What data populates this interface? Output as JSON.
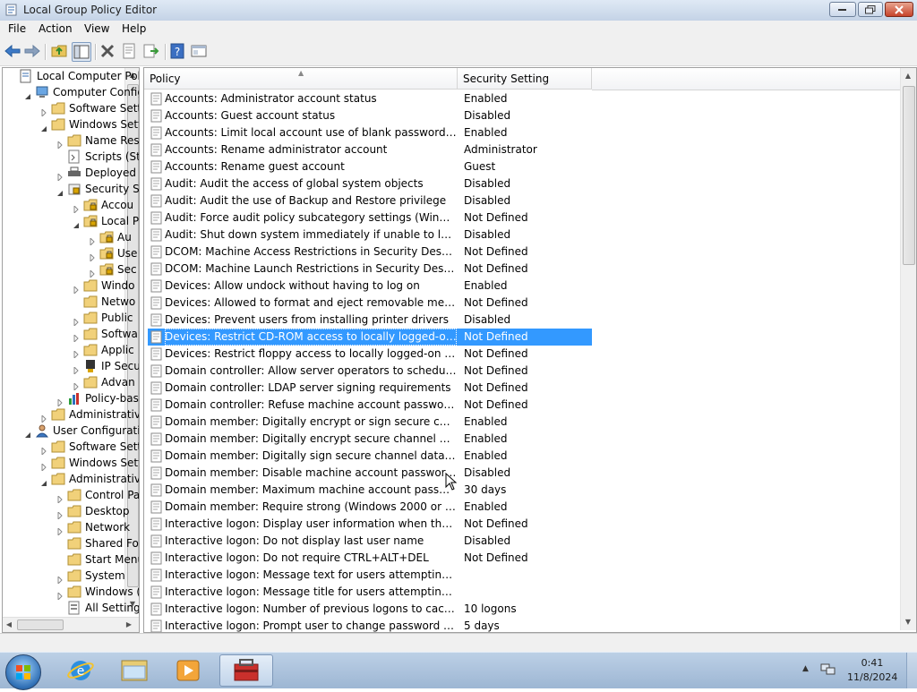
{
  "window": {
    "title": "Local Group Policy Editor"
  },
  "menu": [
    "File",
    "Action",
    "View",
    "Help"
  ],
  "toolbar": {
    "icons": [
      "back-arrow-icon",
      "forward-arrow-icon",
      "up-folder-icon",
      "show-hide-tree-icon",
      "delete-icon",
      "properties-icon",
      "export-list-icon",
      "help-icon",
      "console-view-icon"
    ]
  },
  "tree": {
    "nodes": [
      {
        "label": "Local Computer Polic",
        "depth": 0,
        "arrow": "none",
        "icon": "policy-doc"
      },
      {
        "label": "Computer Config",
        "depth": 1,
        "arrow": "expanded",
        "icon": "computer"
      },
      {
        "label": "Software Setti",
        "depth": 2,
        "arrow": "collapsed",
        "icon": "folder"
      },
      {
        "label": "Windows Sett",
        "depth": 2,
        "arrow": "expanded",
        "icon": "folder"
      },
      {
        "label": "Name Res",
        "depth": 3,
        "arrow": "collapsed",
        "icon": "folder"
      },
      {
        "label": "Scripts (Sta",
        "depth": 3,
        "arrow": "none",
        "icon": "script"
      },
      {
        "label": "Deployed",
        "depth": 3,
        "arrow": "collapsed",
        "icon": "printer"
      },
      {
        "label": "Security Se",
        "depth": 3,
        "arrow": "expanded",
        "icon": "security"
      },
      {
        "label": "Accou",
        "depth": 4,
        "arrow": "collapsed",
        "icon": "folder-lock"
      },
      {
        "label": "Local P",
        "depth": 4,
        "arrow": "expanded",
        "icon": "folder-lock"
      },
      {
        "label": "Au",
        "depth": 5,
        "arrow": "collapsed",
        "icon": "folder-lock"
      },
      {
        "label": "Use",
        "depth": 5,
        "arrow": "collapsed",
        "icon": "folder-lock"
      },
      {
        "label": "Sec",
        "depth": 5,
        "arrow": "collapsed",
        "icon": "folder-lock"
      },
      {
        "label": "Windo",
        "depth": 4,
        "arrow": "collapsed",
        "icon": "folder"
      },
      {
        "label": "Netwo",
        "depth": 4,
        "arrow": "none",
        "icon": "folder"
      },
      {
        "label": "Public",
        "depth": 4,
        "arrow": "collapsed",
        "icon": "folder"
      },
      {
        "label": "Softwa",
        "depth": 4,
        "arrow": "collapsed",
        "icon": "folder"
      },
      {
        "label": "Applic",
        "depth": 4,
        "arrow": "collapsed",
        "icon": "folder"
      },
      {
        "label": "IP Secu",
        "depth": 4,
        "arrow": "collapsed",
        "icon": "ipsec"
      },
      {
        "label": "Advan",
        "depth": 4,
        "arrow": "collapsed",
        "icon": "folder"
      },
      {
        "label": "Policy-bas",
        "depth": 3,
        "arrow": "collapsed",
        "icon": "chart"
      },
      {
        "label": "Administrative",
        "depth": 2,
        "arrow": "collapsed",
        "icon": "folder"
      },
      {
        "label": "User Configuratio",
        "depth": 1,
        "arrow": "expanded",
        "icon": "user"
      },
      {
        "label": "Software Setti",
        "depth": 2,
        "arrow": "collapsed",
        "icon": "folder"
      },
      {
        "label": "Windows Sett",
        "depth": 2,
        "arrow": "collapsed",
        "icon": "folder"
      },
      {
        "label": "Administrative",
        "depth": 2,
        "arrow": "expanded",
        "icon": "folder"
      },
      {
        "label": "Control Pa",
        "depth": 3,
        "arrow": "collapsed",
        "icon": "folder"
      },
      {
        "label": "Desktop",
        "depth": 3,
        "arrow": "collapsed",
        "icon": "folder"
      },
      {
        "label": "Network",
        "depth": 3,
        "arrow": "collapsed",
        "icon": "folder"
      },
      {
        "label": "Shared Fol",
        "depth": 3,
        "arrow": "none",
        "icon": "folder"
      },
      {
        "label": "Start Menu",
        "depth": 3,
        "arrow": "none",
        "icon": "folder"
      },
      {
        "label": "System",
        "depth": 3,
        "arrow": "collapsed",
        "icon": "folder"
      },
      {
        "label": "Windows (",
        "depth": 3,
        "arrow": "collapsed",
        "icon": "folder"
      },
      {
        "label": "All Setting",
        "depth": 3,
        "arrow": "none",
        "icon": "all-settings"
      }
    ]
  },
  "list": {
    "columns": [
      "Policy",
      "Security Setting"
    ],
    "selected_index": 14,
    "rows": [
      {
        "policy": "Accounts: Administrator account status",
        "setting": "Enabled"
      },
      {
        "policy": "Accounts: Guest account status",
        "setting": "Disabled"
      },
      {
        "policy": "Accounts: Limit local account use of blank passwords to co...",
        "setting": "Enabled"
      },
      {
        "policy": "Accounts: Rename administrator account",
        "setting": "Administrator"
      },
      {
        "policy": "Accounts: Rename guest account",
        "setting": "Guest"
      },
      {
        "policy": "Audit: Audit the access of global system objects",
        "setting": "Disabled"
      },
      {
        "policy": "Audit: Audit the use of Backup and Restore privilege",
        "setting": "Disabled"
      },
      {
        "policy": "Audit: Force audit policy subcategory settings (Windows Vis...",
        "setting": "Not Defined"
      },
      {
        "policy": "Audit: Shut down system immediately if unable to log secur...",
        "setting": "Disabled"
      },
      {
        "policy": "DCOM: Machine Access Restrictions in Security Descriptor D...",
        "setting": "Not Defined"
      },
      {
        "policy": "DCOM: Machine Launch Restrictions in Security Descriptor ...",
        "setting": "Not Defined"
      },
      {
        "policy": "Devices: Allow undock without having to log on",
        "setting": "Enabled"
      },
      {
        "policy": "Devices: Allowed to format and eject removable media",
        "setting": "Not Defined"
      },
      {
        "policy": "Devices: Prevent users from installing printer drivers",
        "setting": "Disabled"
      },
      {
        "policy": "Devices: Restrict CD-ROM access to locally logged-on user ...",
        "setting": "Not Defined"
      },
      {
        "policy": "Devices: Restrict floppy access to locally logged-on user only",
        "setting": "Not Defined"
      },
      {
        "policy": "Domain controller: Allow server operators to schedule tasks",
        "setting": "Not Defined"
      },
      {
        "policy": "Domain controller: LDAP server signing requirements",
        "setting": "Not Defined"
      },
      {
        "policy": "Domain controller: Refuse machine account password chan...",
        "setting": "Not Defined"
      },
      {
        "policy": "Domain member: Digitally encrypt or sign secure channel d...",
        "setting": "Enabled"
      },
      {
        "policy": "Domain member: Digitally encrypt secure channel data (wh...",
        "setting": "Enabled"
      },
      {
        "policy": "Domain member: Digitally sign secure channel data (when ...",
        "setting": "Enabled"
      },
      {
        "policy": "Domain member: Disable machine account password chan...",
        "setting": "Disabled"
      },
      {
        "policy": "Domain member: Maximum machine account password age",
        "setting": "30 days"
      },
      {
        "policy": "Domain member: Require strong (Windows 2000 or later) se...",
        "setting": "Enabled"
      },
      {
        "policy": "Interactive logon: Display user information when the session...",
        "setting": "Not Defined"
      },
      {
        "policy": "Interactive logon: Do not display last user name",
        "setting": "Disabled"
      },
      {
        "policy": "Interactive logon: Do not require CTRL+ALT+DEL",
        "setting": "Not Defined"
      },
      {
        "policy": "Interactive logon: Message text for users attempting to log on",
        "setting": ""
      },
      {
        "policy": "Interactive logon: Message title for users attempting to log on",
        "setting": ""
      },
      {
        "policy": "Interactive logon: Number of previous logons to cache (in c...",
        "setting": "10 logons"
      },
      {
        "policy": "Interactive logon: Prompt user to change password before e...",
        "setting": "5 days"
      }
    ]
  },
  "taskbar": {
    "apps": [
      "internet-explorer-icon",
      "windows-explorer-icon",
      "media-player-icon",
      "group-policy-editor-icon"
    ],
    "clock_time": "0:41",
    "clock_date": "11/8/2024",
    "tray_expand": "▲"
  },
  "colors": {
    "selection": "#3399ff",
    "title_bar": "#c4d3e6",
    "taskbar": "#9db6d3"
  }
}
